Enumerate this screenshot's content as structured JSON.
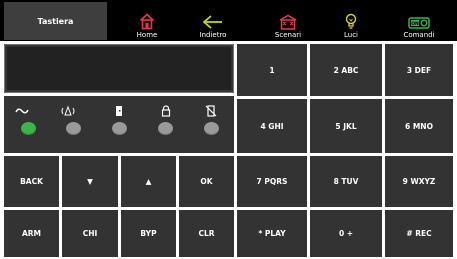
{
  "title": "Tastiera",
  "nav": {
    "home": "Home",
    "back": "Indietro",
    "scenari": "Scenari",
    "luci": "Luci",
    "comandi": "Comandi",
    "comandi_icon_text": "ON"
  },
  "colors": {
    "home_icon": "#e23b4a",
    "back_icon": "#c8d61c",
    "scenari_icon": "#e23b4a",
    "luci_icon": "#d9cf3a",
    "comandi_icon": "#3db34a",
    "led_on": "#3db34a",
    "led_off": "#9a9a9a"
  },
  "status_indicators": [
    {
      "icon": "power-wave-icon",
      "state": "on"
    },
    {
      "icon": "alarm-icon",
      "state": "off"
    },
    {
      "icon": "open-door-icon",
      "state": "off"
    },
    {
      "icon": "lock-icon",
      "state": "off"
    },
    {
      "icon": "bypass-icon",
      "state": "off"
    }
  ],
  "keypad": {
    "k1": "1",
    "k2": "2 ABC",
    "k3": "3 DEF",
    "k4": "4 GHI",
    "k5": "5 JKL",
    "k6": "6 MNO",
    "k7": "7 PQRS",
    "k8": "8 TUV",
    "k9": "9 WXYZ",
    "kstar": "* PLAY",
    "k0": "0 +",
    "khash": "# REC"
  },
  "controls": {
    "back": "BACK",
    "down": "▼",
    "up": "▲",
    "ok": "OK",
    "arm": "ARM",
    "chi": "CHI",
    "byp": "BYP",
    "clr": "CLR"
  }
}
